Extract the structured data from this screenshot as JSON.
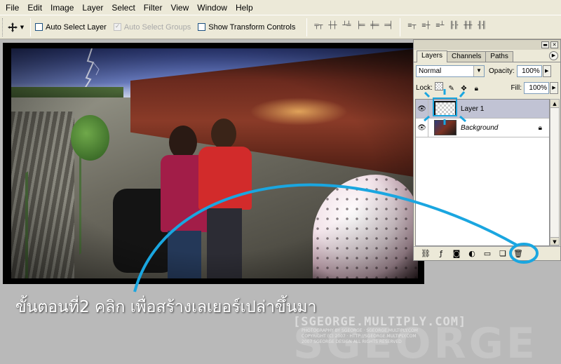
{
  "menu": [
    "File",
    "Edit",
    "Image",
    "Layer",
    "Select",
    "Filter",
    "View",
    "Window",
    "Help"
  ],
  "options_bar": {
    "tool_icon": "move-tool-icon",
    "auto_select_layer": "Auto Select Layer",
    "auto_select_groups": "Auto Select Groups",
    "show_transform_controls": "Show Transform Controls",
    "align_icons": [
      "align-top-icon",
      "align-vcenter-icon",
      "align-bottom-icon",
      "align-left-icon",
      "align-hcenter-icon",
      "align-right-icon"
    ],
    "distribute_icons": [
      "distribute-top-icon",
      "distribute-vcenter-icon",
      "distribute-bottom-icon",
      "distribute-left-icon",
      "distribute-hcenter-icon",
      "distribute-right-icon"
    ]
  },
  "layers_panel": {
    "tabs": [
      "Layers",
      "Channels",
      "Paths"
    ],
    "active_tab": "Layers",
    "blend_mode": "Normal",
    "opacity_label": "Opacity:",
    "opacity_value": "100%",
    "lock_label": "Lock:",
    "fill_label": "Fill:",
    "fill_value": "100%",
    "layers": [
      {
        "name": "Layer 1",
        "selected": true
      },
      {
        "name": "Background",
        "selected": false,
        "locked": true
      }
    ]
  },
  "caption": "ขั้นตอนที่2  คลิก  เพื่อสร้างเลเยอร์เปล่าขึ้นมา",
  "watermark": {
    "main": "[SGEORGE.MULTIPLY.COM]",
    "small_1": "PHOTOGRAPHY BY SGEORGE · SGEORGE.MULTIPLY.COM",
    "small_2": "COPYRIGHT (C) 2007 · HTTP://SGEORGE.MULTIPLY.COM",
    "small_3": "2007 SGEORGE DESIGN ALL RIGHTS RESERVED",
    "background": "SGEORGE"
  },
  "colors": {
    "ui_bg": "#ece9d8",
    "highlight": "#1aa6e0",
    "selected_layer": "#c1c3d4"
  }
}
